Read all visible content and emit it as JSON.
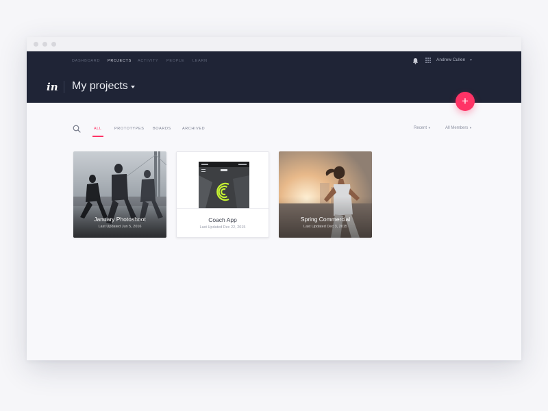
{
  "nav": {
    "items": [
      "DASHBOARD",
      "PROJECTS",
      "ACTIVITY",
      "PEOPLE",
      "LEARN"
    ],
    "active": "PROJECTS"
  },
  "user": {
    "name": "Andrew Cullen"
  },
  "header": {
    "logo": "in",
    "title": "My projects"
  },
  "filters": {
    "tabs": [
      "ALL",
      "PROTOTYPES",
      "BOARDS",
      "ARCHIVED"
    ],
    "active": "ALL",
    "sort": "Recent",
    "members": "All Members"
  },
  "projects": [
    {
      "title": "January Photoshoot",
      "updated": "Last Updated Jun 5, 2016"
    },
    {
      "title": "Coach App",
      "updated": "Last Updated Dec 22, 2015"
    },
    {
      "title": "Spring Commercial",
      "updated": "Last Updated Dec 3, 2015"
    }
  ],
  "colors": {
    "accent": "#ff3366",
    "header_bg": "#1f2436",
    "page_bg": "#f8f8fb",
    "coach_green": "#c6f432"
  },
  "icons": {
    "fab": "plus-icon",
    "search": "search-icon",
    "notifications": "bell-icon",
    "apps": "grid-icon"
  }
}
